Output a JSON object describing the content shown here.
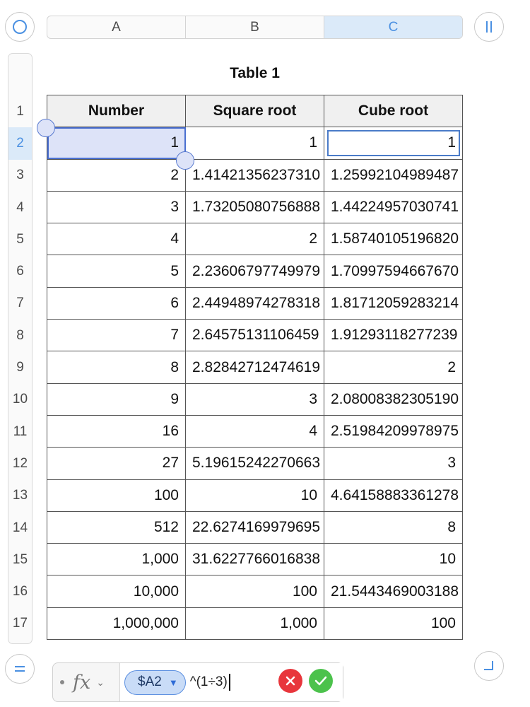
{
  "columns": [
    {
      "label": "A",
      "selected": false
    },
    {
      "label": "B",
      "selected": false
    },
    {
      "label": "C",
      "selected": true
    }
  ],
  "rows": [
    "1",
    "2",
    "3",
    "4",
    "5",
    "6",
    "7",
    "8",
    "9",
    "10",
    "11",
    "12",
    "13",
    "14",
    "15",
    "16",
    "17"
  ],
  "selected_row": "2",
  "table": {
    "title": "Table 1",
    "headers": [
      "Number",
      "Square root",
      "Cube root"
    ],
    "cells": [
      [
        "1",
        "1",
        "1"
      ],
      [
        "2",
        "1.41421356237310",
        "1.25992104989487"
      ],
      [
        "3",
        "1.73205080756888",
        "1.44224957030741"
      ],
      [
        "4",
        "2",
        "1.58740105196820"
      ],
      [
        "5",
        "2.23606797749979",
        "1.70997594667670"
      ],
      [
        "6",
        "2.44948974278318",
        "1.81712059283214"
      ],
      [
        "7",
        "2.64575131106459",
        "1.91293118277239"
      ],
      [
        "8",
        "2.82842712474619",
        "2"
      ],
      [
        "9",
        "3",
        "2.08008382305190"
      ],
      [
        "16",
        "4",
        "2.51984209978975"
      ],
      [
        "27",
        "5.19615242270663",
        "3"
      ],
      [
        "100",
        "10",
        "4.64158883361278"
      ],
      [
        "512",
        "22.6274169979695",
        "8"
      ],
      [
        "1,000",
        "31.6227766016838",
        "10"
      ],
      [
        "10,000",
        "100",
        "21.5443469003188"
      ],
      [
        "1,000,000",
        "1,000",
        "100"
      ]
    ]
  },
  "formula": {
    "fx_label": "fx",
    "reference": "$A2",
    "expression": "^(1÷3)"
  },
  "colors": {
    "accent": "#4a90e2",
    "cancel": "#e8363c",
    "accept": "#4cc24c"
  }
}
